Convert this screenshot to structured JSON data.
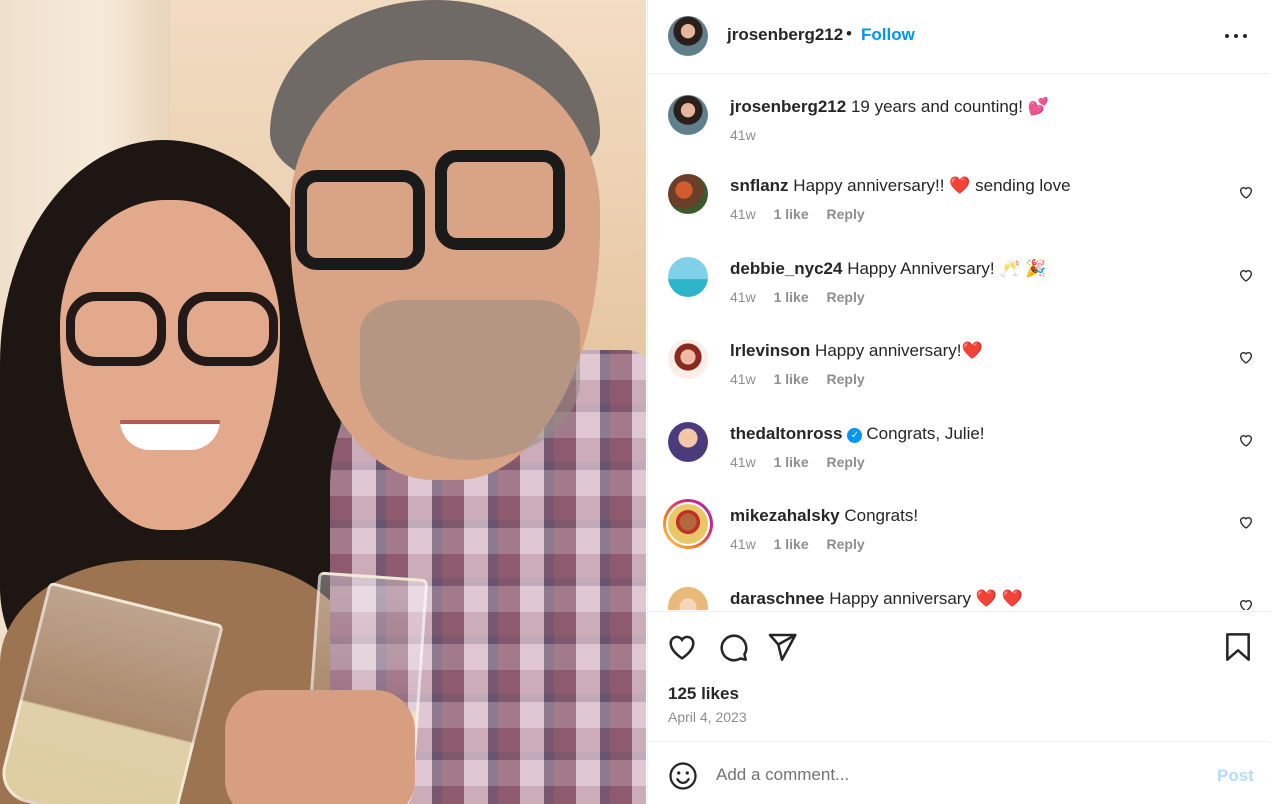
{
  "post": {
    "username": "jrosenberg212",
    "separator": "•",
    "follow_label": "Follow",
    "more_icon": "more-horizontal-icon",
    "photo_description_icon": "post-photo"
  },
  "caption": {
    "username": "jrosenberg212",
    "text": "19 years and counting!",
    "emoji": "💕",
    "age": "41w"
  },
  "comments": [
    {
      "username": "snflanz",
      "text": "Happy anniversary!!",
      "emoji": "❤️",
      "text2": "sending love",
      "age": "41w",
      "likes": "1 like",
      "reply": "Reply"
    },
    {
      "username": "debbie_nyc24",
      "text": "Happy Anniversary!",
      "emoji": "🥂 🎉",
      "text2": "",
      "age": "41w",
      "likes": "1 like",
      "reply": "Reply"
    },
    {
      "username": "lrlevinson",
      "text": "Happy anniversary!",
      "emoji": "❤️",
      "text2": "",
      "age": "41w",
      "likes": "1 like",
      "reply": "Reply"
    },
    {
      "username": "thedaltonross",
      "verified": "✓",
      "text": "Congrats, Julie!",
      "emoji": "",
      "text2": "",
      "age": "41w",
      "likes": "1 like",
      "reply": "Reply"
    },
    {
      "username": "mikezahalsky",
      "text": "Congrats!",
      "emoji": "",
      "text2": "",
      "age": "41w",
      "likes": "1 like",
      "reply": "Reply"
    },
    {
      "username": "daraschnee",
      "text": "Happy anniversary",
      "emoji": "❤️ ❤️",
      "text2": "",
      "age": "",
      "likes": "",
      "reply": ""
    }
  ],
  "actions": {
    "likes": "125 likes",
    "date": "April 4, 2023",
    "icons": [
      "heart-icon",
      "comment-icon",
      "share-icon",
      "bookmark-icon"
    ]
  },
  "compose": {
    "placeholder": "Add a comment...",
    "post_label": "Post",
    "emoji_icon": "emoji-smile-icon"
  },
  "colors": {
    "link_blue": "#0095f6",
    "post_disabled": "#b3dbff",
    "muted": "#8e8e8e",
    "text": "#262626",
    "heart_red": "#ed4956"
  }
}
